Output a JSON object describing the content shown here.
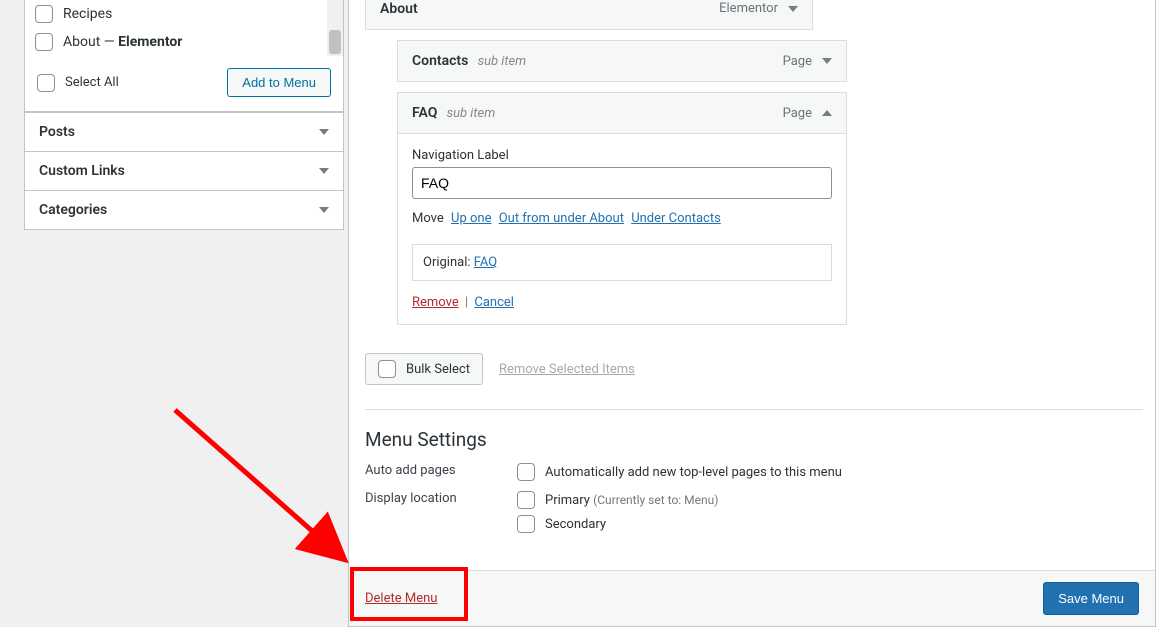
{
  "sidebar": {
    "pages": {
      "items": [
        {
          "label": "Recipes"
        },
        {
          "label_pre": "About — ",
          "label_strong": "Elementor"
        }
      ],
      "select_all": "Select All",
      "add_button": "Add to Menu"
    },
    "accordions": [
      {
        "label": "Posts"
      },
      {
        "label": "Custom Links"
      },
      {
        "label": "Categories"
      }
    ]
  },
  "menu": {
    "about": {
      "title": "About",
      "type": "Elementor"
    },
    "contacts": {
      "title": "Contacts",
      "sub": "sub item",
      "type": "Page"
    },
    "faq": {
      "title": "FAQ",
      "sub": "sub item",
      "type": "Page",
      "nav_label_field": "Navigation Label",
      "nav_label_value": "FAQ",
      "move_label": "Move",
      "move_up": "Up one",
      "move_out": "Out from under About",
      "move_under": "Under Contacts",
      "original_label": "Original:",
      "original_link": "FAQ",
      "remove": "Remove",
      "cancel": "Cancel"
    },
    "bulk_select": "Bulk Select",
    "remove_selected": "Remove Selected Items"
  },
  "settings": {
    "heading": "Menu Settings",
    "auto_label": "Auto add pages",
    "auto_option": "Automatically add new top-level pages to this menu",
    "display_label": "Display location",
    "primary_label": "Primary ",
    "primary_paren": "(Currently set to: Menu)",
    "secondary_label": "Secondary"
  },
  "footer": {
    "delete": "Delete Menu",
    "save": "Save Menu"
  }
}
